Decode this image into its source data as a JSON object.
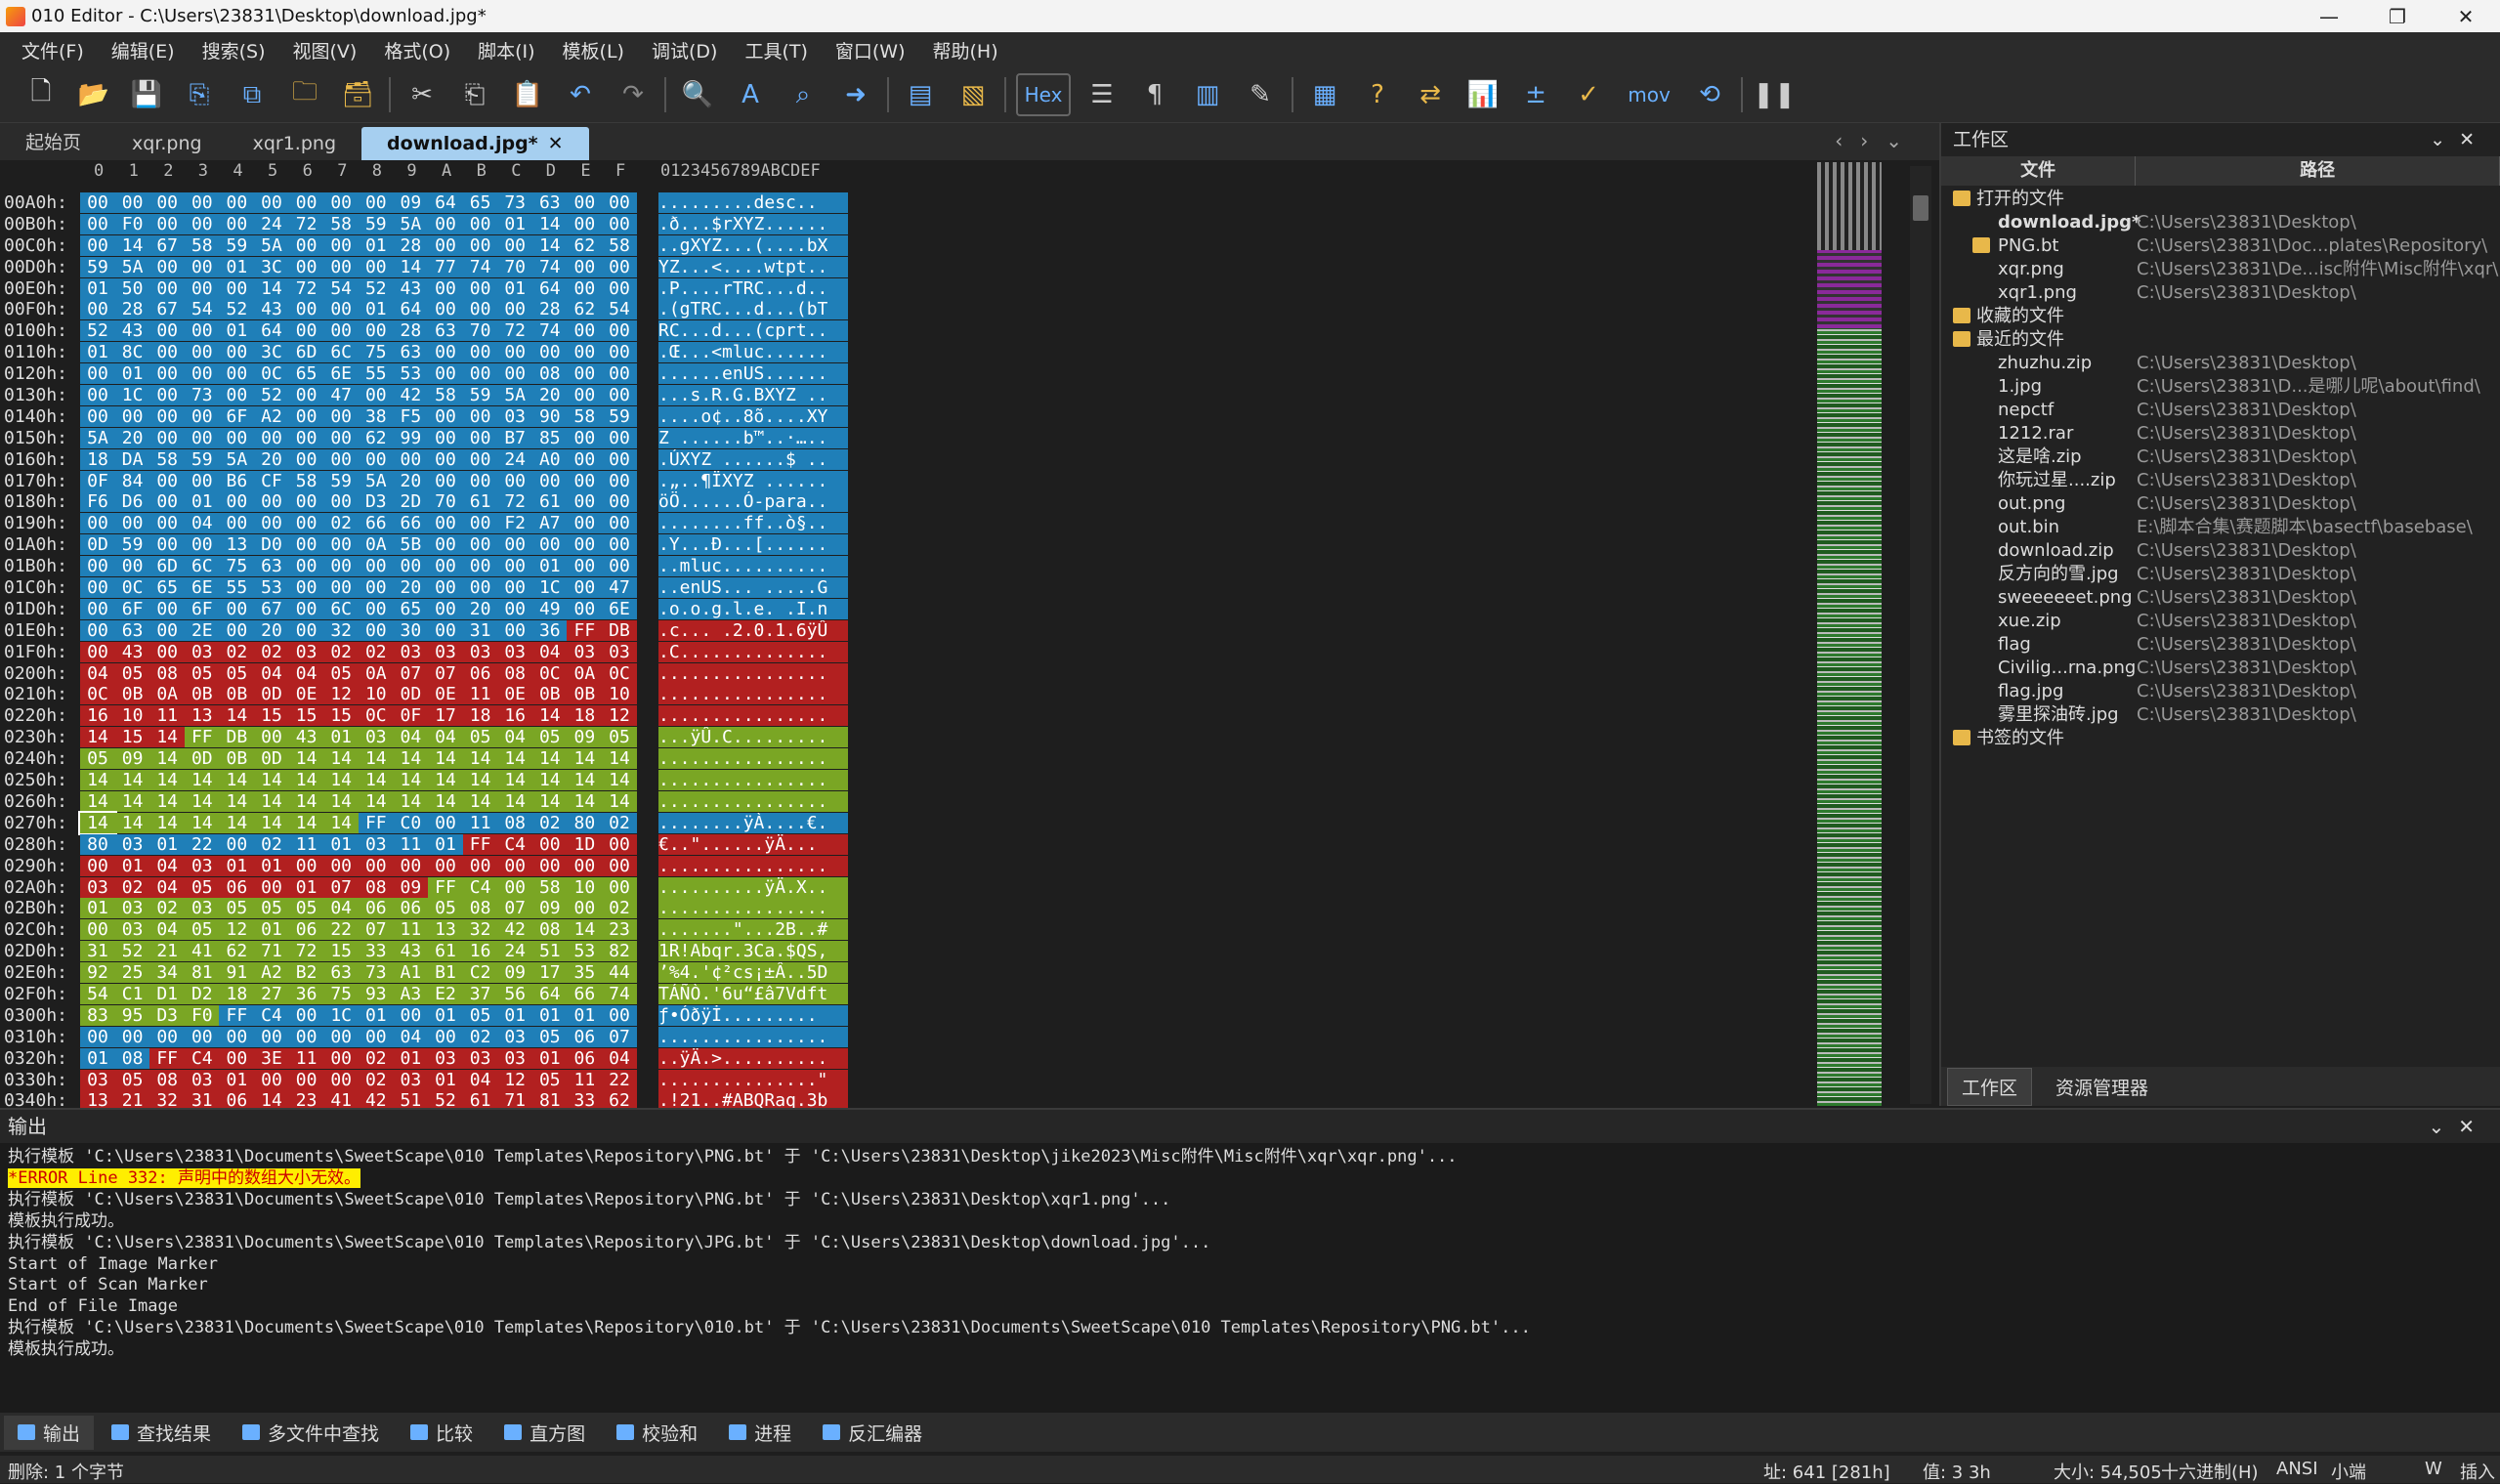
{
  "window": {
    "title": "010 Editor - C:\\Users\\23831\\Desktop\\download.jpg*",
    "min": "—",
    "max": "❐",
    "close": "✕"
  },
  "menu": [
    "文件(F)",
    "编辑(E)",
    "搜索(S)",
    "视图(V)",
    "格式(O)",
    "脚本(I)",
    "模板(L)",
    "调试(D)",
    "工具(T)",
    "窗口(W)",
    "帮助(H)"
  ],
  "toolbar": {
    "hex_label": "Hex",
    "mov_label": "mov"
  },
  "tabs": [
    {
      "label": "起始页"
    },
    {
      "label": "xqr.png"
    },
    {
      "label": "xqr1.png"
    },
    {
      "label": "download.jpg*",
      "active": true
    }
  ],
  "hex": {
    "col_headers": [
      "0",
      "1",
      "2",
      "3",
      "4",
      "5",
      "6",
      "7",
      "8",
      "9",
      "A",
      "B",
      "C",
      "D",
      "E",
      "F"
    ],
    "text_header": "0123456789ABCDEF",
    "rows": [
      {
        "a": "00A0h:",
        "b": "00 00 00 00 00 00 00 00 00 09 64 65 73 63 00 00",
        "t": ".........desc..",
        "c": "0000000000000000"
      },
      {
        "a": "00B0h:",
        "b": "00 F0 00 00 00 24 72 58 59 5A 00 00 01 14 00 00",
        "t": ".ð...$rXYZ......",
        "c": "0000000000000000"
      },
      {
        "a": "00C0h:",
        "b": "00 14 67 58 59 5A 00 00 01 28 00 00 00 14 62 58",
        "t": "..gXYZ...(....bX",
        "c": "0000000000000000"
      },
      {
        "a": "00D0h:",
        "b": "59 5A 00 00 01 3C 00 00 00 14 77 74 70 74 00 00",
        "t": "YZ...<....wtpt..",
        "c": "0000000000000000"
      },
      {
        "a": "00E0h:",
        "b": "01 50 00 00 00 14 72 54 52 43 00 00 01 64 00 00",
        "t": ".P....rTRC...d..",
        "c": "0000000000000000"
      },
      {
        "a": "00F0h:",
        "b": "00 28 67 54 52 43 00 00 01 64 00 00 00 28 62 54",
        "t": ".(gTRC...d...(bT",
        "c": "0000000000000000"
      },
      {
        "a": "0100h:",
        "b": "52 43 00 00 01 64 00 00 00 28 63 70 72 74 00 00",
        "t": "RC...d...(cprt..",
        "c": "0000000000000000"
      },
      {
        "a": "0110h:",
        "b": "01 8C 00 00 00 3C 6D 6C 75 63 00 00 00 00 00 00",
        "t": ".Œ...<mluc......",
        "c": "0000000000000000"
      },
      {
        "a": "0120h:",
        "b": "00 01 00 00 00 0C 65 6E 55 53 00 00 00 08 00 00",
        "t": "......enUS......",
        "c": "0000000000000000"
      },
      {
        "a": "0130h:",
        "b": "00 1C 00 73 00 52 00 47 00 42 58 59 5A 20 00 00",
        "t": "...s.R.G.BXYZ ..",
        "c": "0000000000000000"
      },
      {
        "a": "0140h:",
        "b": "00 00 00 00 6F A2 00 00 38 F5 00 00 03 90 58 59",
        "t": "....o¢..8õ....XY",
        "c": "0000000000000000"
      },
      {
        "a": "0150h:",
        "b": "5A 20 00 00 00 00 00 00 62 99 00 00 B7 85 00 00",
        "t": "Z ......b™..·…..",
        "c": "0000000000000000"
      },
      {
        "a": "0160h:",
        "b": "18 DA 58 59 5A 20 00 00 00 00 00 00 24 A0 00 00",
        "t": ".ÚXYZ ......$ ..",
        "c": "0000000000000000"
      },
      {
        "a": "0170h:",
        "b": "0F 84 00 00 B6 CF 58 59 5A 20 00 00 00 00 00 00",
        "t": ".„..¶ÏXYZ ......",
        "c": "0000000000000000"
      },
      {
        "a": "0180h:",
        "b": "F6 D6 00 01 00 00 00 00 D3 2D 70 61 72 61 00 00",
        "t": "öÖ......Ó-para..",
        "c": "0000000000000000"
      },
      {
        "a": "0190h:",
        "b": "00 00 00 04 00 00 00 02 66 66 00 00 F2 A7 00 00",
        "t": "........ff..ò§..",
        "c": "0000000000000000"
      },
      {
        "a": "01A0h:",
        "b": "0D 59 00 00 13 D0 00 00 0A 5B 00 00 00 00 00 00",
        "t": ".Y...Ð...[......",
        "c": "0000000000000000"
      },
      {
        "a": "01B0h:",
        "b": "00 00 6D 6C 75 63 00 00 00 00 00 00 00 01 00 00",
        "t": "..mluc..........",
        "c": "0000000000000000"
      },
      {
        "a": "01C0h:",
        "b": "00 0C 65 6E 55 53 00 00 00 20 00 00 00 1C 00 47",
        "t": "..enUS... .....G",
        "c": "0000000000000000"
      },
      {
        "a": "01D0h:",
        "b": "00 6F 00 6F 00 67 00 6C 00 65 00 20 00 49 00 6E",
        "t": ".o.o.g.l.e. .I.n",
        "c": "0000000000000000"
      },
      {
        "a": "01E0h:",
        "b": "00 63 00 2E 00 20 00 32 00 30 00 31 00 36 FF DB",
        "t": ".c... .2.0.1.6ÿÛ",
        "c": "0000000000000011"
      },
      {
        "a": "01F0h:",
        "b": "00 43 00 03 02 02 03 02 02 03 03 03 03 04 03 03",
        "t": ".C..............",
        "c": "1111111111111111"
      },
      {
        "a": "0200h:",
        "b": "04 05 08 05 05 04 04 05 0A 07 07 06 08 0C 0A 0C",
        "t": "................",
        "c": "1111111111111111"
      },
      {
        "a": "0210h:",
        "b": "0C 0B 0A 0B 0B 0D 0E 12 10 0D 0E 11 0E 0B 0B 10",
        "t": "................",
        "c": "1111111111111111"
      },
      {
        "a": "0220h:",
        "b": "16 10 11 13 14 15 15 15 0C 0F 17 18 16 14 18 12",
        "t": "................",
        "c": "1111111111111111"
      },
      {
        "a": "0230h:",
        "b": "14 15 14 FF DB 00 43 01 03 04 04 05 04 05 09 05",
        "t": "...ÿÛ.C.........",
        "c": "1112222222222222"
      },
      {
        "a": "0240h:",
        "b": "05 09 14 0D 0B 0D 14 14 14 14 14 14 14 14 14 14",
        "t": "................",
        "c": "2222222222222222"
      },
      {
        "a": "0250h:",
        "b": "14 14 14 14 14 14 14 14 14 14 14 14 14 14 14 14",
        "t": "................",
        "c": "2222222222222222"
      },
      {
        "a": "0260h:",
        "b": "14 14 14 14 14 14 14 14 14 14 14 14 14 14 14 14",
        "t": "................",
        "c": "2222222222222222"
      },
      {
        "a": "0270h:",
        "b": "14 14 14 14 14 14 14 14 FF C0 00 11 08 02 80 02",
        "t": "........ÿÀ....€.",
        "c": "2222222200000000"
      },
      {
        "a": "0280h:",
        "b": "80 03 01 22 00 02 11 01 03 11 01 FF C4 00 1D 00",
        "t": "€..\"......ÿÄ...",
        "c": "0000000000011111"
      },
      {
        "a": "0290h:",
        "b": "00 01 04 03 01 01 00 00 00 00 00 00 00 00 00 00",
        "t": "................",
        "c": "1111111111111111"
      },
      {
        "a": "02A0h:",
        "b": "03 02 04 05 06 00 01 07 08 09 FF C4 00 58 10 00",
        "t": "..........ÿÄ.X..",
        "c": "1111111111222222"
      },
      {
        "a": "02B0h:",
        "b": "01 03 02 03 05 05 05 04 06 06 05 08 07 09 00 02",
        "t": "................",
        "c": "2222222222222222"
      },
      {
        "a": "02C0h:",
        "b": "00 03 04 05 12 01 06 22 07 11 13 32 42 08 14 23",
        "t": ".......\"...2B..#",
        "c": "2222222222222222"
      },
      {
        "a": "02D0h:",
        "b": "31 52 21 41 62 71 72 15 33 43 61 16 24 51 53 82",
        "t": "1R!Abqr.3Ca.$QS‚",
        "c": "2222222222222222"
      },
      {
        "a": "02E0h:",
        "b": "92 25 34 81 91 A2 B2 63 73 A1 B1 C2 09 17 35 44",
        "t": "’%4.'¢²cs¡±Â..5D",
        "c": "2222222222222222"
      },
      {
        "a": "02F0h:",
        "b": "54 C1 D1 D2 18 27 36 75 93 A3 E2 37 56 64 66 74",
        "t": "TÁÑÒ.'6u“£â7Vdft",
        "c": "2222222222222222"
      },
      {
        "a": "0300h:",
        "b": "83 95 D3 F0 FF C4 00 1C 01 00 01 05 01 01 01 00",
        "t": "ƒ•Óðÿİ.........",
        "c": "2222000000000000"
      },
      {
        "a": "0310h:",
        "b": "00 00 00 00 00 00 00 00 00 04 00 02 03 05 06 07",
        "t": "................",
        "c": "0000000000000000"
      },
      {
        "a": "0320h:",
        "b": "01 08 FF C4 00 3E 11 00 02 01 03 03 03 01 06 04",
        "t": "..ÿÄ.>..........",
        "c": "0011111111111111"
      },
      {
        "a": "0330h:",
        "b": "03 05 08 03 01 00 00 00 02 03 01 04 12 05 11 22",
        "t": "...............\"",
        "c": "1111111111111111"
      },
      {
        "a": "0340h:",
        "b": "13 21 32 31 06 14 23 41 42 51 52 61 71 81 33 62",
        "t": ".!21..#ABQRaq.3b",
        "c": "1111111111111111"
      }
    ]
  },
  "workspace": {
    "title": "工作区",
    "col_file": "文件",
    "col_path": "路径",
    "groups": [
      {
        "label": "打开的文件",
        "items": [
          {
            "name": "download.jpg*",
            "path": "C:\\Users\\23831\\Desktop\\",
            "bold": true
          },
          {
            "name": "PNG.bt",
            "path": "C:\\Users\\23831\\Doc...plates\\Repository\\"
          },
          {
            "name": "xqr.png",
            "path": "C:\\Users\\23831\\De...isc附件\\Misc附件\\xqr\\"
          },
          {
            "name": "xqr1.png",
            "path": "C:\\Users\\23831\\Desktop\\"
          }
        ]
      },
      {
        "label": "收藏的文件",
        "items": []
      },
      {
        "label": "最近的文件",
        "items": [
          {
            "name": "zhuzhu.zip",
            "path": "C:\\Users\\23831\\Desktop\\"
          },
          {
            "name": "1.jpg",
            "path": "C:\\Users\\23831\\D...是哪儿呢\\about\\find\\"
          },
          {
            "name": "nepctf",
            "path": "C:\\Users\\23831\\Desktop\\"
          },
          {
            "name": "1212.rar",
            "path": "C:\\Users\\23831\\Desktop\\"
          },
          {
            "name": "这是啥.zip",
            "path": "C:\\Users\\23831\\Desktop\\"
          },
          {
            "name": "你玩过星....zip",
            "path": "C:\\Users\\23831\\Desktop\\"
          },
          {
            "name": "out.png",
            "path": "C:\\Users\\23831\\Desktop\\"
          },
          {
            "name": "out.bin",
            "path": "E:\\脚本合集\\赛题脚本\\basectf\\basebase\\"
          },
          {
            "name": "download.zip",
            "path": "C:\\Users\\23831\\Desktop\\"
          },
          {
            "name": "反方向的雪.jpg",
            "path": "C:\\Users\\23831\\Desktop\\"
          },
          {
            "name": "sweeeeeet.png",
            "path": "C:\\Users\\23831\\Desktop\\"
          },
          {
            "name": "xue.zip",
            "path": "C:\\Users\\23831\\Desktop\\"
          },
          {
            "name": "flag",
            "path": "C:\\Users\\23831\\Desktop\\"
          },
          {
            "name": "Civilig...rna.png",
            "path": "C:\\Users\\23831\\Desktop\\"
          },
          {
            "name": "flag.jpg",
            "path": "C:\\Users\\23831\\Desktop\\"
          },
          {
            "name": "雾里探油砖.jpg",
            "path": "C:\\Users\\23831\\Desktop\\"
          }
        ]
      },
      {
        "label": "书签的文件",
        "items": []
      }
    ],
    "tab_workspace": "工作区",
    "tab_explorer": "资源管理器"
  },
  "output": {
    "title": "输出",
    "lines": [
      "执行模板 'C:\\Users\\23831\\Documents\\SweetScape\\010 Templates\\Repository\\PNG.bt' 于 'C:\\Users\\23831\\Desktop\\jike2023\\Misc附件\\Misc附件\\xqr\\xqr.png'...",
      "*ERROR Line 332: 声明中的数组大小无效。",
      "执行模板 'C:\\Users\\23831\\Documents\\SweetScape\\010 Templates\\Repository\\PNG.bt' 于 'C:\\Users\\23831\\Desktop\\xqr1.png'...",
      "模板执行成功。",
      "执行模板 'C:\\Users\\23831\\Documents\\SweetScape\\010 Templates\\Repository\\JPG.bt' 于 'C:\\Users\\23831\\Desktop\\download.jpg'...",
      "Start of Image Marker",
      "Start of Scan Marker",
      "End of File Image",
      "执行模板 'C:\\Users\\23831\\Documents\\SweetScape\\010 Templates\\Repository\\010.bt' 于 'C:\\Users\\23831\\Documents\\SweetScape\\010 Templates\\Repository\\PNG.bt'...",
      "模板执行成功。"
    ]
  },
  "bottom_tabs": [
    "输出",
    "查找结果",
    "多文件中查找",
    "比较",
    "直方图",
    "校验和",
    "进程",
    "反汇编器"
  ],
  "status": {
    "left": "删除: 1 个字节",
    "addr": "址: 641 [281h]",
    "val": "值: 3 3h",
    "size": "大小: 54,505",
    "mode": "十六进制(H)",
    "enc": "ANSI",
    "endian": "小端",
    "w": "W",
    "ins": "插入"
  }
}
